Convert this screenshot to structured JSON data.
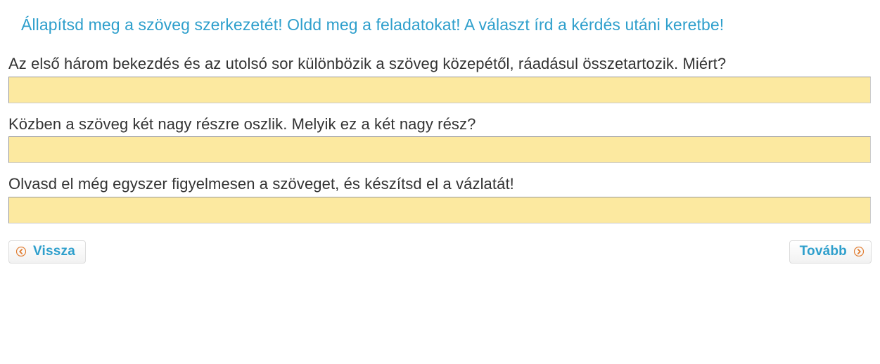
{
  "header": "Állapítsd meg a szöveg szerkezetét! Oldd meg a feladatokat! A választ írd a kérdés utáni keretbe!",
  "questions": [
    {
      "text": "Az első három bekezdés és az utolsó sor különbözik a szöveg közepétől, ráadásul összetartozik. Miért?",
      "value": ""
    },
    {
      "text": "Közben a szöveg két nagy részre oszlik. Melyik ez a két nagy rész?",
      "value": ""
    },
    {
      "text": "Olvasd el még egyszer figyelmesen a szöveget, és készítsd el a vázlatát!",
      "value": ""
    }
  ],
  "nav": {
    "back_label": "Vissza",
    "next_label": "Tovább"
  },
  "colors": {
    "accent": "#2e9fcc",
    "field_bg": "#fce9a0",
    "arrow": "#e07b2f"
  }
}
